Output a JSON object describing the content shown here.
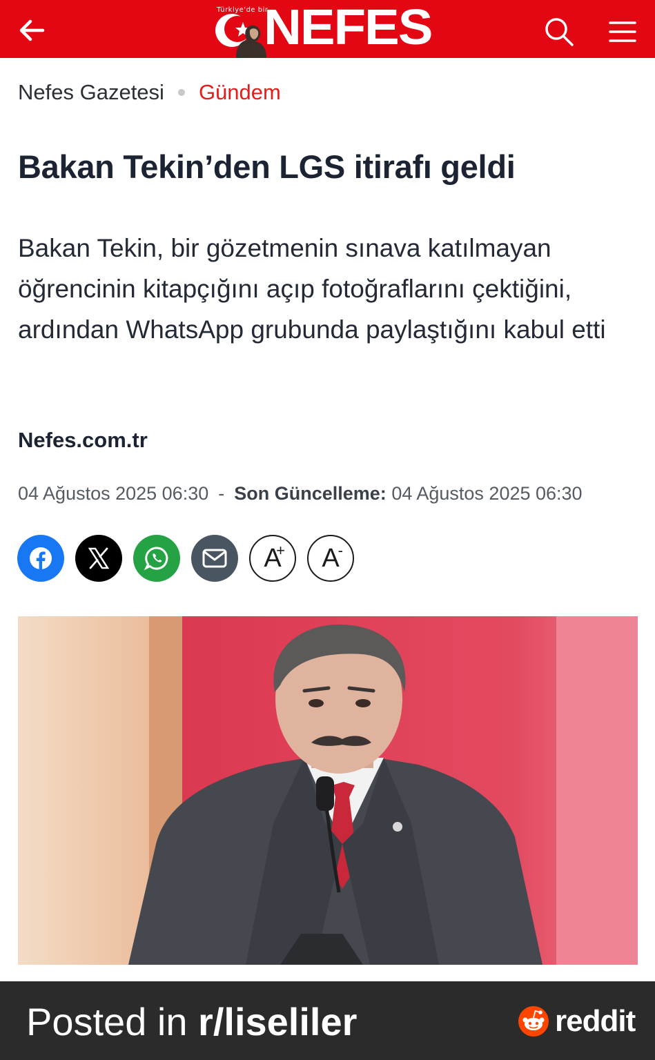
{
  "header": {
    "logo_tagline": "Türkiye'de bir",
    "logo_text": "NEFES",
    "colors": {
      "bar": "#e30613"
    },
    "icons": [
      "back-arrow-icon",
      "search-icon",
      "hamburger-menu-icon"
    ]
  },
  "breadcrumb": {
    "site": "Nefes Gazetesi",
    "category": "Gündem"
  },
  "article": {
    "headline": "Bakan Tekin’den LGS itirafı geldi",
    "summary": "Bakan Tekin, bir gözetmenin sınava katılmayan öğrencinin kitapçığını açıp fotoğraflarını çektiğini, ardından WhatsApp grubunda paylaştığını kabul etti",
    "source": "Nefes.com.tr",
    "published": "04 Ağustos 2025 06:30",
    "dash": "-",
    "updated_label": "Son Güncelleme:",
    "updated": "04 Ağustos 2025 06:30"
  },
  "share": {
    "buttons": [
      {
        "icon": "facebook-icon",
        "color": "#1877f2"
      },
      {
        "icon": "x-icon",
        "color": "#000000"
      },
      {
        "icon": "whatsapp-icon",
        "color": "#25a244"
      },
      {
        "icon": "mail-icon",
        "color": "#4a5562"
      }
    ],
    "font_increase": {
      "letter": "A",
      "sign": "+"
    },
    "font_decrease": {
      "letter": "A",
      "sign": "-"
    }
  },
  "footer": {
    "posted_prefix": "Posted in ",
    "subreddit": "r/liseliler",
    "brand": "reddit",
    "colors": {
      "bar": "#2b2b2b",
      "reddit": "#ff4500"
    }
  }
}
